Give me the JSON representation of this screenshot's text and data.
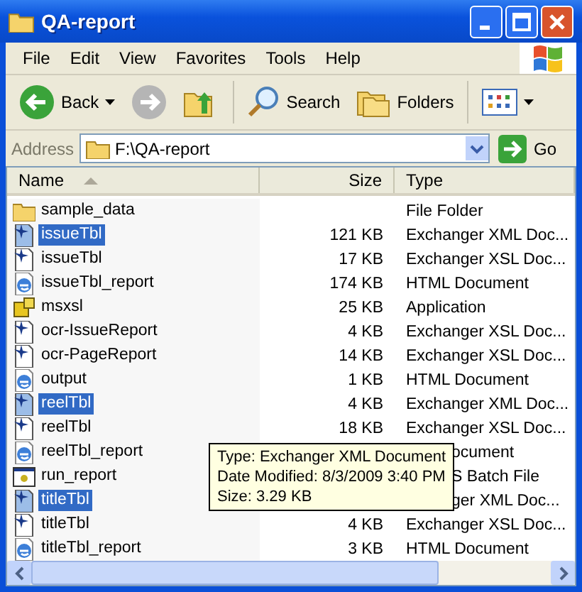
{
  "window": {
    "title": "QA-report"
  },
  "menu": [
    "File",
    "Edit",
    "View",
    "Favorites",
    "Tools",
    "Help"
  ],
  "toolbar": {
    "back": "Back",
    "search": "Search",
    "folders": "Folders"
  },
  "address": {
    "label": "Address",
    "value": "F:\\QA-report",
    "go": "Go"
  },
  "columns": [
    {
      "label": "Name",
      "sorted": true
    },
    {
      "label": "Size",
      "sorted": false
    },
    {
      "label": "Type",
      "sorted": false
    }
  ],
  "rows": [
    {
      "kind": "folder",
      "name": "sample_data",
      "type": "File Folder",
      "selected": false
    },
    {
      "kind": "exchanger",
      "name": "issueTbl",
      "size": "121 KB",
      "type": "Exchanger XML Doc...",
      "selected": true
    },
    {
      "kind": "exchanger",
      "name": "issueTbl",
      "size": "17 KB",
      "type": "Exchanger XSL Doc...",
      "selected": false
    },
    {
      "kind": "html",
      "name": "issueTbl_report",
      "size": "174 KB",
      "type": "HTML Document",
      "selected": false
    },
    {
      "kind": "app",
      "name": "msxsl",
      "size": "25 KB",
      "type": "Application",
      "selected": false
    },
    {
      "kind": "exchanger",
      "name": "ocr-IssueReport",
      "size": "4 KB",
      "type": "Exchanger XSL Doc...",
      "selected": false
    },
    {
      "kind": "exchanger",
      "name": "ocr-PageReport",
      "size": "14 KB",
      "type": "Exchanger XSL Doc...",
      "selected": false
    },
    {
      "kind": "html",
      "name": "output",
      "size": "1 KB",
      "type": "HTML Document",
      "selected": false
    },
    {
      "kind": "exchanger",
      "name": "reelTbl",
      "size": "4 KB",
      "type": "Exchanger XML Doc...",
      "selected": true
    },
    {
      "kind": "exchanger",
      "name": "reelTbl",
      "size": "18 KB",
      "type": "Exchanger XSL Doc...",
      "selected": false
    },
    {
      "kind": "html",
      "name": "reelTbl_report",
      "type": "ocument",
      "partial": true,
      "selected": false
    },
    {
      "kind": "batch",
      "name": "run_report",
      "type": "S Batch File",
      "partial": true,
      "selected": false
    },
    {
      "kind": "exchanger",
      "name": "titleTbl",
      "type": "ger XML Doc...",
      "partial": true,
      "selected": true
    },
    {
      "kind": "exchanger",
      "name": "titleTbl",
      "size": "4 KB",
      "type": "Exchanger XSL Doc...",
      "selected": false
    },
    {
      "kind": "html",
      "name": "titleTbl_report",
      "size": "3 KB",
      "type": "HTML Document",
      "selected": false
    }
  ],
  "tooltip": [
    "Type: Exchanger XML Document",
    "Date Modified: 8/3/2009 3:40 PM",
    "Size: 3.29 KB"
  ]
}
